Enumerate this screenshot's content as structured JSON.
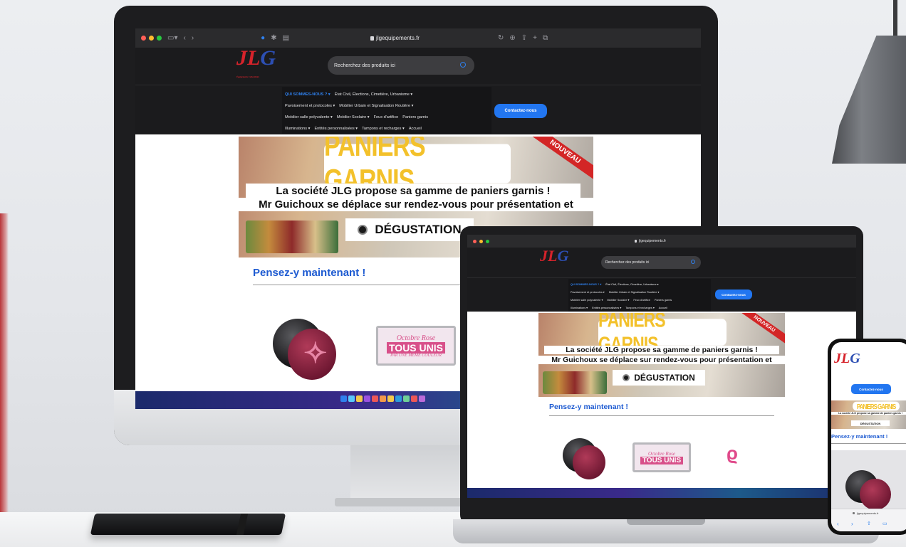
{
  "browser": {
    "url": "jlgequipements.fr"
  },
  "site": {
    "logo_text_1": "JL",
    "logo_text_2": "G",
    "logo_subtitle": "Équipements Collectivités",
    "search_placeholder": "Recherchez des produits ici",
    "menu_rows": [
      [
        "QUI SOMMES-NOUS ? ▾",
        "État Civil, Élections, Cimetière, Urbanisme ▾"
      ],
      [
        "Pavoisement et protocoles ▾",
        "Mobilier Urbain et Signalisation Routière ▾"
      ],
      [
        "Mobilier salle polyvalente ▾",
        "Mobilier Scolaire ▾",
        "Feux d'artifice",
        "Paniers garnis"
      ],
      [
        "Illuminations ▾",
        "Entités personnalisées ▾",
        "Tampons et recharges ▾",
        "Accueil"
      ]
    ],
    "contact_button": "Contactez-nous",
    "banner": {
      "title": "PANIERS GARNIS",
      "ribbon": "NOUVEAU",
      "line1": "La société JLG propose sa gamme de paniers garnis !",
      "line2": "Mr Guichoux se déplace sur rendez-vous pour présentation et",
      "tasting": "DÉGUSTATION"
    },
    "section_heading": "Pensez-y maintenant !",
    "barrier": {
      "line1": "Octobre Rose",
      "line2": "TOUS UNIS",
      "line3": "PAR UNE MÊME COULEUR"
    }
  },
  "colors": {
    "accent_blue": "#2276f0",
    "heading_blue": "#1e5bd1",
    "banner_yellow": "#f3c12b",
    "ribbon_red": "#d32626",
    "pink": "#d8508a"
  }
}
